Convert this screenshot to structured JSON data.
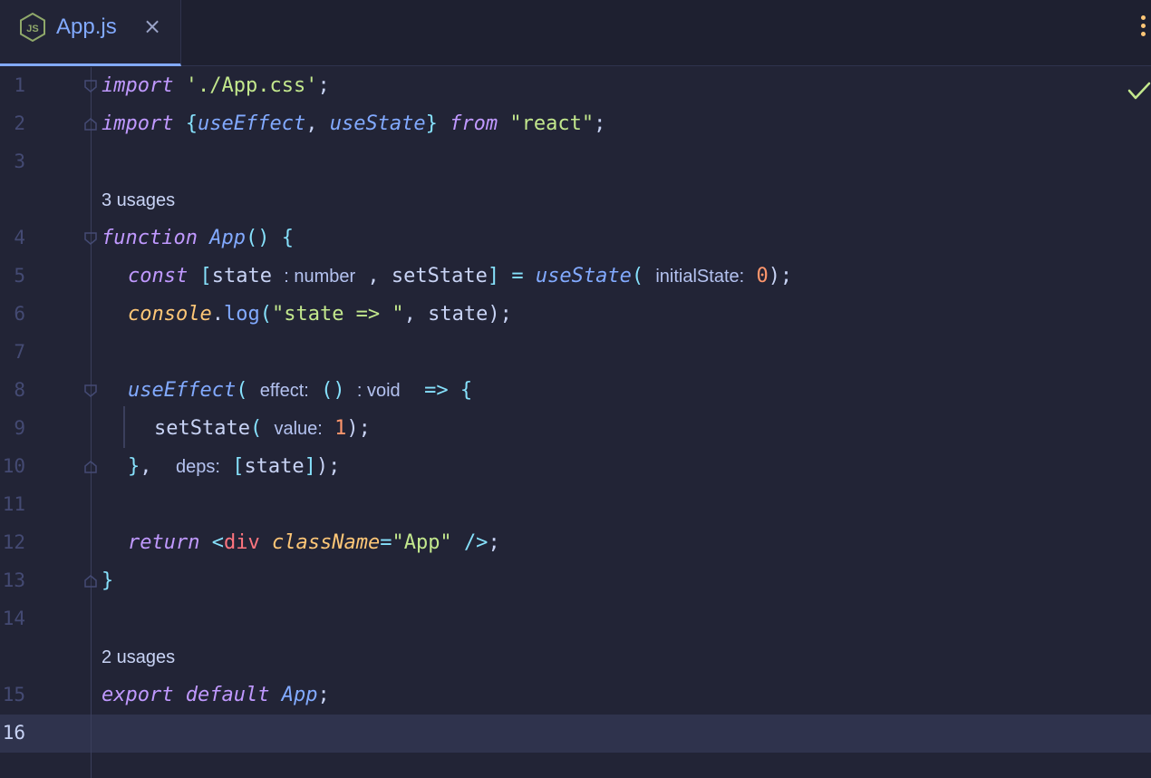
{
  "tab": {
    "title": "App.js",
    "icon": "nodejs-icon",
    "close": "×"
  },
  "toolbar": {
    "menu_icon": "kebab-menu-icon",
    "status_icon": "check-icon"
  },
  "colors": {
    "background": "#222436",
    "accent": "#82aaff",
    "keyword": "#c099ff",
    "string": "#c3e88d",
    "number": "#ff966c"
  },
  "editor": {
    "line_numbers": [
      "1",
      "2",
      "3",
      "4",
      "5",
      "6",
      "7",
      "8",
      "9",
      "10",
      "11",
      "12",
      "13",
      "14",
      "15",
      "16"
    ],
    "current_line": "16",
    "lenses": {
      "app_usages": "3 usages",
      "export_usages": "2 usages"
    },
    "l1": {
      "import": "import",
      "path": "'./App.css'",
      "semi": ";"
    },
    "l2": {
      "import": "import",
      "lbrace": "{",
      "useEffect": "useEffect",
      "comma": ",",
      "useState": "useState",
      "rbrace": "}",
      "from": "from",
      "module": "\"react\"",
      "semi": ";"
    },
    "l4": {
      "function": "function",
      "name": "App",
      "parens": "()",
      "lbrace": "{"
    },
    "l5": {
      "const": "const",
      "lbracket": "[",
      "state": "state",
      "type_hint": ": number",
      "comma": ",",
      "setState": "setState",
      "rbracket": "]",
      "eq": "=",
      "useState": "useState",
      "lparen": "(",
      "param_hint": "initialState:",
      "value": "0",
      "end": ");"
    },
    "l6": {
      "console": "console",
      "dot": ".",
      "log": "log",
      "lparen": "(",
      "str": "\"state => \"",
      "comma": ",",
      "state": "state",
      "end": ");"
    },
    "l8": {
      "useEffect": "useEffect",
      "lparen": "(",
      "param_hint": "effect:",
      "arrow_params": "()",
      "type_hint": ": void",
      "arrow": "=>",
      "lbrace": "{"
    },
    "l9": {
      "setState": "setState",
      "lparen": "(",
      "param_hint": "value:",
      "value": "1",
      "end": ");"
    },
    "l10": {
      "rbrace": "}",
      "comma": ",",
      "param_hint": "deps:",
      "lbracket": "[",
      "state": "state",
      "rbracket": "]",
      "end": ");"
    },
    "l12": {
      "return": "return",
      "lt": "<",
      "tag": "div",
      "attr": "className",
      "eq": "=",
      "value": "\"App\"",
      "close": "/>",
      "semi": ";"
    },
    "l13": {
      "rbrace": "}"
    },
    "l15": {
      "export": "export",
      "default": "default",
      "name": "App",
      "semi": ";"
    }
  }
}
